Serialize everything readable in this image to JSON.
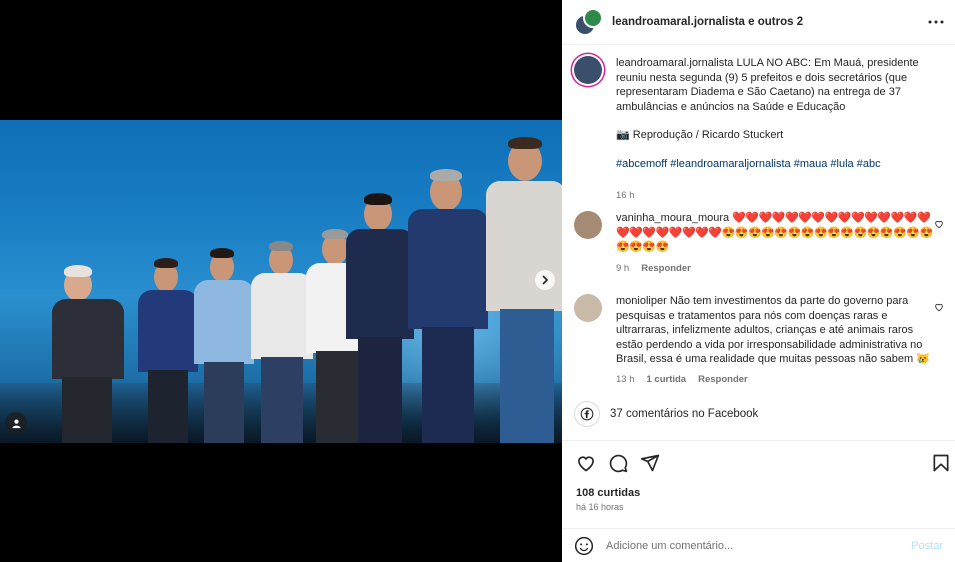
{
  "header": {
    "title": "leandroamaral.jornalista e outros 2"
  },
  "caption": {
    "username": "leandroamaral.jornalista",
    "text": "LULA NO ABC: Em Mauá, presidente reuniu nesta segunda (9) 5 prefeitos e dois secretários (que representaram Diadema e São Caetano) na entrega de 37 ambulâncias e anúncios na Saúde e Educação",
    "credit": "📷 Reprodução / Ricardo Stuckert",
    "hashtags": "#abcemoff #leandroamaraljornalista #maua #lula #abc",
    "time": "16 h"
  },
  "comments": [
    {
      "username": "vaninha_moura_moura",
      "text": "❤️❤️❤️❤️❤️❤️❤️❤️❤️❤️❤️❤️❤️❤️❤️❤️❤️❤️❤️❤️❤️❤️❤️😍😍😍😍😍😍😍😍😍😍😍😍😍😍😍😍😍😍😍😍",
      "time": "9 h",
      "reply_label": "Responder"
    },
    {
      "username": "monioliper",
      "text": "Não tem investimentos da parte do governo para pesquisas e tratamentos para nós com doenças raras e ultrarraras, infelizmente adultos, crianças e até animais raros estão perdendo a vida por irresponsabilidade administrativa no Brasil, essa é uma realidade que muitas pessoas não sabem 😿",
      "time": "13 h",
      "likes_label": "1 curtida",
      "reply_label": "Responder"
    }
  ],
  "facebook": {
    "text": "37 comentários no Facebook"
  },
  "actions": {
    "likes": "108 curtidas",
    "time_ago": "há 16 horas"
  },
  "composer": {
    "placeholder": "Adicione um comentário...",
    "post_label": "Postar"
  },
  "carousel": {
    "slide_count": 10,
    "active_index": 0
  },
  "colors": {
    "link": "#00376b",
    "meta": "#737373",
    "post_button_disabled": "#b2dffc",
    "story_ring": "#d6249f"
  }
}
